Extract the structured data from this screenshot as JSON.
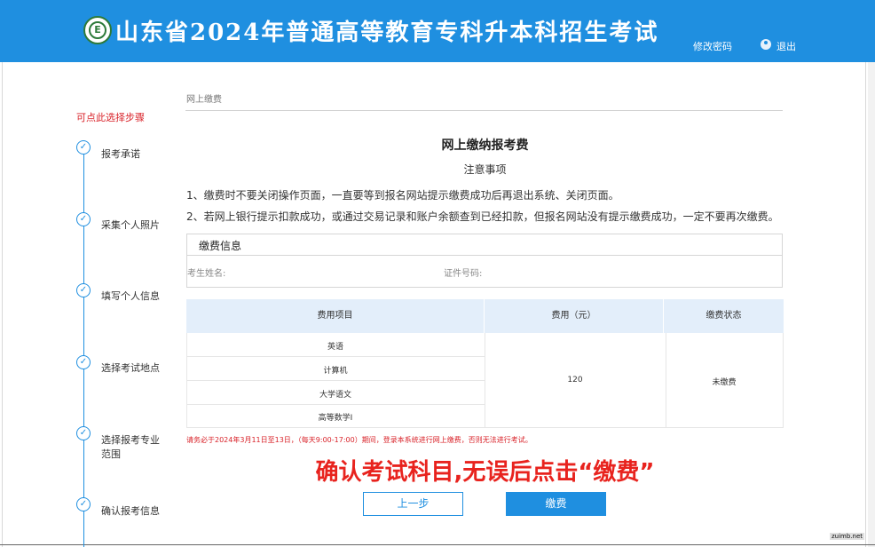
{
  "header": {
    "title": "山东省2024年普通高等教育专科升本科招生考试",
    "change_password": "修改密码",
    "logout": "退出",
    "bg_color": "#1f8fe0"
  },
  "sidebar": {
    "hint": "可点此选择步骤",
    "steps": [
      {
        "label": "报考承诺",
        "done": true
      },
      {
        "label": "采集个人照片",
        "done": true
      },
      {
        "label": "填写个人信息",
        "done": true
      },
      {
        "label": "选择考试地点",
        "done": true
      },
      {
        "label": "选择报考专业范围",
        "done": true
      },
      {
        "label": "确认报考信息",
        "done": true
      }
    ]
  },
  "main": {
    "breadcrumb": "网上缴费",
    "title": "网上缴纳报考费",
    "notice_title": "注意事项",
    "notes": [
      "1、缴费时不要关闭操作页面，一直要等到报名网站提示缴费成功后再退出系统、关闭页面。",
      "2、若网上银行提示扣款成功，或通过交易记录和账户余额查到已经扣款，但报名网站没有提示缴费成功，一定不要再次缴费。"
    ],
    "payment_info": {
      "title": "缴费信息",
      "name_label": "考生姓名:",
      "id_label": "证件号码:"
    },
    "fee_table": {
      "headers": [
        "费用项目",
        "费用（元）",
        "缴费状态"
      ],
      "items": [
        "英语",
        "计算机",
        "大学语文",
        "高等数学I"
      ],
      "amount": "120",
      "status": "未缴费"
    },
    "warning": "请务必于2024年3月11日至13日，（每天9:00-17:00）期间，登录本系统进行网上缴费，否则无法进行考试。",
    "overlay_text": "确认考试科目,无误后点击“缴费”",
    "buttons": {
      "prev": "上一步",
      "pay": "缴费"
    },
    "accent_color": "#1f8fe0",
    "alert_color": "#d9232a"
  },
  "watermark": "zuimb.net"
}
